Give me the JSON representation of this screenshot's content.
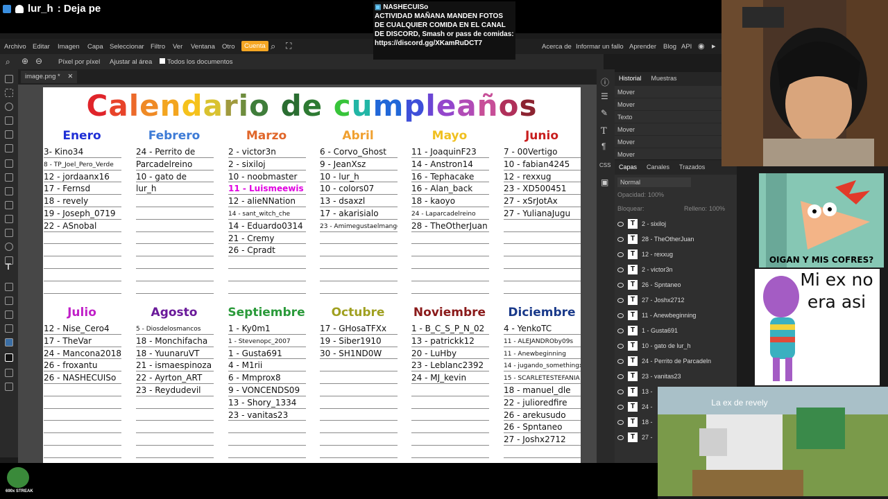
{
  "stream": {
    "chat_user": "lur_h",
    "chat_message": ": Deja pe",
    "streak_label": "690x STREAK"
  },
  "notification": {
    "username": "NASHECUISo",
    "message": "ACTIVIDAD MAÑANA  MANDEN FOTOS DE CUALQUIER COMIDA EN EL CANAL DE DISCORD, Smash or pass de comidas:",
    "link": "https://discord.gg/XKamRuDCT7"
  },
  "menu": {
    "items": [
      "Archivo",
      "Editar",
      "Imagen",
      "Capa",
      "Seleccionar",
      "Filtro",
      "Ver",
      "Ventana",
      "Otro"
    ],
    "account": "Cuenta",
    "right_links": [
      "Acerca de",
      "Informar un fallo",
      "Aprender",
      "Blog",
      "API"
    ]
  },
  "toolbar": {
    "pixel_label": "Píxel por píxel",
    "fit_label": "Ajustar al área",
    "all_docs_label": "Todos los documentos"
  },
  "document": {
    "tab_label": "image.png *",
    "title_letters": [
      {
        "ch": "C",
        "color": "#e0242a"
      },
      {
        "ch": "a",
        "color": "#e8432a"
      },
      {
        "ch": "l",
        "color": "#ec6a2a"
      },
      {
        "ch": "e",
        "color": "#ef8a25"
      },
      {
        "ch": "n",
        "color": "#f3a51f"
      },
      {
        "ch": "d",
        "color": "#f5c21c"
      },
      {
        "ch": "a",
        "color": "#d9c230"
      },
      {
        "ch": "r",
        "color": "#a09a3e"
      },
      {
        "ch": "i",
        "color": "#6e8d3e"
      },
      {
        "ch": "o",
        "color": "#3f7d3a"
      },
      {
        "ch": " ",
        "color": "#000000"
      },
      {
        "ch": "d",
        "color": "#2a6d31"
      },
      {
        "ch": "e",
        "color": "#2d7a32"
      },
      {
        "ch": " ",
        "color": "#000000"
      },
      {
        "ch": "c",
        "color": "#38c43a"
      },
      {
        "ch": "u",
        "color": "#22b6a6"
      },
      {
        "ch": "m",
        "color": "#2167d8"
      },
      {
        "ch": "p",
        "color": "#3e4fd9"
      },
      {
        "ch": "l",
        "color": "#6b46d4"
      },
      {
        "ch": "e",
        "color": "#9446cc"
      },
      {
        "ch": "a",
        "color": "#b14bb6"
      },
      {
        "ch": "ñ",
        "color": "#c74f98"
      },
      {
        "ch": "o",
        "color": "#b0305a"
      },
      {
        "ch": "s",
        "color": "#8c2331"
      }
    ],
    "months": [
      {
        "name": "Enero",
        "color": "#1f2fd6",
        "entries": [
          "3- Kino34",
          "8 - TP_Joel_Pero_Verde",
          "12 - jordaanx16",
          "17 - Fernsd",
          "18 - revely",
          "19 - Joseph_0719",
          "22 - ASnobal"
        ]
      },
      {
        "name": "Febrero",
        "color": "#3d7bd6",
        "entries": [
          "24 - Perrito de",
          "Parcadelreino",
          "10 - gato de",
          "lur_h"
        ]
      },
      {
        "name": "Marzo",
        "color": "#e0662a",
        "entries": [
          "2 - victor3n",
          "2 - sixiloj",
          "10 - noobmaster",
          "11 - Luismeewis",
          "12 - alieNNation",
          "14 - sant_witch_che",
          "14 - Eduardo0314",
          "21 - Cremy",
          "26 - Cpradt"
        ]
      },
      {
        "name": "Abril",
        "color": "#f0a030",
        "entries": [
          "6 - Corvo_Ghost",
          "9 - JeanXsz",
          "10 - lur_h",
          "10 - colors07",
          "13 - dsaxzl",
          "17 - akarisialo",
          "23 - Amimegustaelmango"
        ]
      },
      {
        "name": "Mayo",
        "color": "#f0c020",
        "entries": [
          "11 - JoaquinF23",
          "14 - Anstron14",
          "16 - Tephacake",
          "16 - Alan_back",
          "18 - kaoyo",
          "24 - Laparcadelreino",
          "28 - TheOtherJuan"
        ]
      },
      {
        "name": "Junio",
        "color": "#c81e1e",
        "entries": [
          "7 - 00Vertigo",
          "10 - fabian4245",
          "12 - rexxug",
          "23 - XD500451",
          "27 - xSrJotAx",
          "27 - YulianaJugu"
        ]
      },
      {
        "name": "Julio",
        "color": "#c020c8",
        "entries": [
          "12 - Nise_Cero4",
          "17 - TheVar",
          "24 - Mancona2018",
          "26 - froxantu",
          "26 - NASHECUISo"
        ]
      },
      {
        "name": "Agosto",
        "color": "#6a1a9a",
        "entries": [
          "5 - Diosdelosmancos",
          "18 - Monchifacha",
          "18 - YuunaruVT",
          "21 - ismaespinoza",
          "22 - Ayrton_ART",
          "23 - Reydudevil"
        ]
      },
      {
        "name": "Septiembre",
        "color": "#2a9a3a",
        "entries": [
          "1 - Ky0m1",
          "1 - Stevenopc_2007",
          "1 - Gusta691",
          "4 - M1rii",
          "6 - Mmprox8",
          "9 - VONCENDS09",
          "13 - Shory_1334",
          "23 - vanitas23"
        ]
      },
      {
        "name": "Octubre",
        "color": "#a0a020",
        "entries": [
          "17 - GHosaTFXx",
          "19 - Siber1910",
          "30 - SH1ND0W"
        ]
      },
      {
        "name": "Noviembre",
        "color": "#8a1a1a",
        "entries": [
          "1 - B_C_S_P_N_02",
          "13 - patrickk12",
          "20 - LuHby",
          "23 - Leblanc2392",
          "24 - MJ_kevin"
        ]
      },
      {
        "name": "Diciembre",
        "color": "#1a3a8a",
        "entries": [
          "4 - YenkoTC",
          "11 - ALEJANDROby09s",
          "11 - Anewbeginning",
          "14 - jugando_somethingxd",
          "15 - SCARLETESTEFANIA",
          "18 - manuel_dle",
          "22 - julioredfire",
          "26 - arekusudo",
          "26 - Spntaneo",
          "27 - Joshx2712"
        ]
      }
    ]
  },
  "history": {
    "tabs": [
      "Historial",
      "Muestras"
    ],
    "items": [
      "Mover",
      "Mover",
      "Texto",
      "Mover",
      "Mover",
      "Mover"
    ]
  },
  "layers": {
    "tabs": [
      "Capas",
      "Canales",
      "Trazados"
    ],
    "blend": "Normal",
    "opacity_label": "Opacidad:",
    "opacity": "100%",
    "lock_label": "Bloquear:",
    "fill_label": "Relleno:",
    "fill": "100%",
    "items": [
      "2 - sixiloj",
      "28 - TheOtherJuan",
      "12 - rexxug",
      "2 - victor3n",
      "26 - Spntaneo",
      "27 - Joshx2712",
      "11 - Anewbeginning",
      "1 - Gusta691",
      "10 - gato de lur_h",
      "24 - Perrito de Parcadeln",
      "23 - vanitas23",
      "13 -",
      "24 -",
      "18 -",
      "27 -"
    ]
  },
  "memes": {
    "phineas_caption": "OIGAN Y MIS COFRES?",
    "austin_text": "Mi ex no era asi",
    "mc_caption": "La ex de revely"
  }
}
